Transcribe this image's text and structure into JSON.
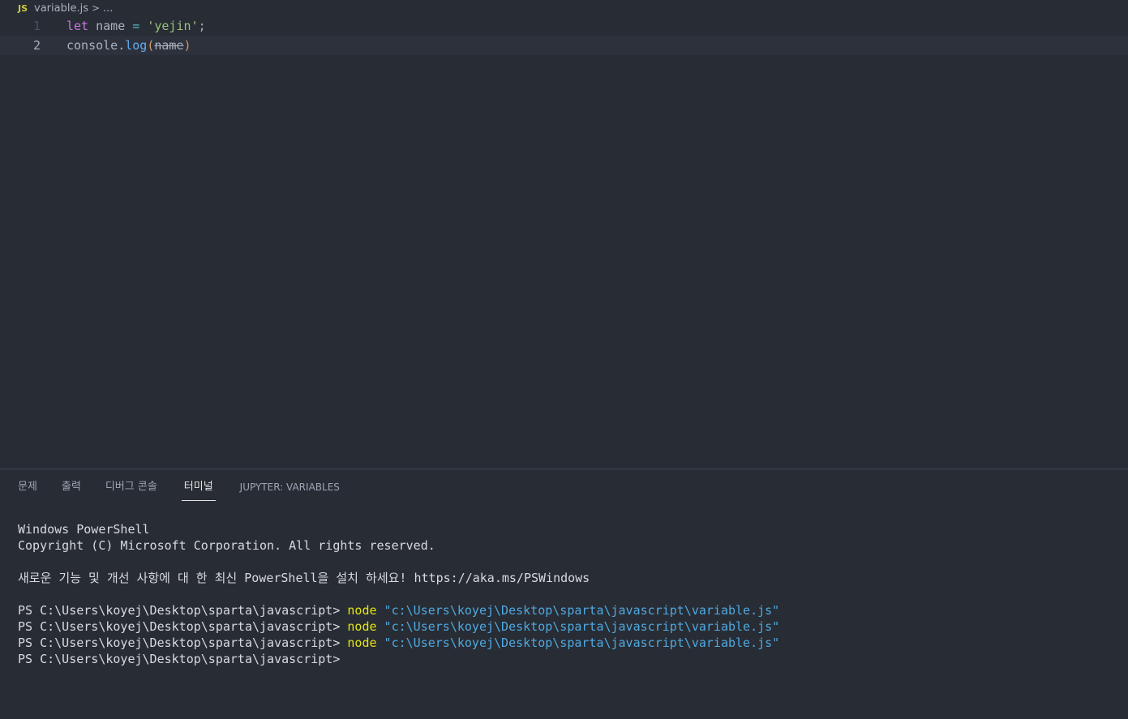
{
  "breadcrumb": {
    "js_badge": "JS",
    "file": "variable.js",
    "separator": ">",
    "more": "..."
  },
  "editor": {
    "lines": [
      {
        "number": "1",
        "tokens": {
          "kw": "let",
          "var": " name ",
          "op": "=",
          "space": " ",
          "str": "'yejin'",
          "end": ";"
        }
      },
      {
        "number": "2",
        "tokens": {
          "obj": "console.",
          "fn": "log",
          "open": "(",
          "arg": "name",
          "close": ")"
        }
      }
    ]
  },
  "panel": {
    "tabs": [
      {
        "label": "문제"
      },
      {
        "label": "출력"
      },
      {
        "label": "디버그 콘솔"
      },
      {
        "label": "터미널"
      },
      {
        "label": "JUPYTER: VARIABLES"
      }
    ],
    "active_tab": "터미널"
  },
  "terminal": {
    "header1": "Windows PowerShell",
    "header2": "Copyright (C) Microsoft Corporation. All rights reserved.",
    "notice": "새로운 기능 및 개선 사항에 대 한 최신 PowerShell을 설치 하세요! https://aka.ms/PSWindows",
    "prompt": "PS C:\\Users\\koyej\\Desktop\\sparta\\javascript> ",
    "command": "node",
    "arg": "\"c:\\Users\\koyej\\Desktop\\sparta\\javascript\\variable.js\"",
    "final_prompt": "PS C:\\Users\\koyej\\Desktop\\sparta\\javascript>"
  },
  "colors": {
    "background": "#282c34",
    "keyword": "#c678dd",
    "string": "#98c379",
    "function": "#61afef",
    "terminal_command": "#e5e510",
    "terminal_string": "#4fa9e0"
  }
}
